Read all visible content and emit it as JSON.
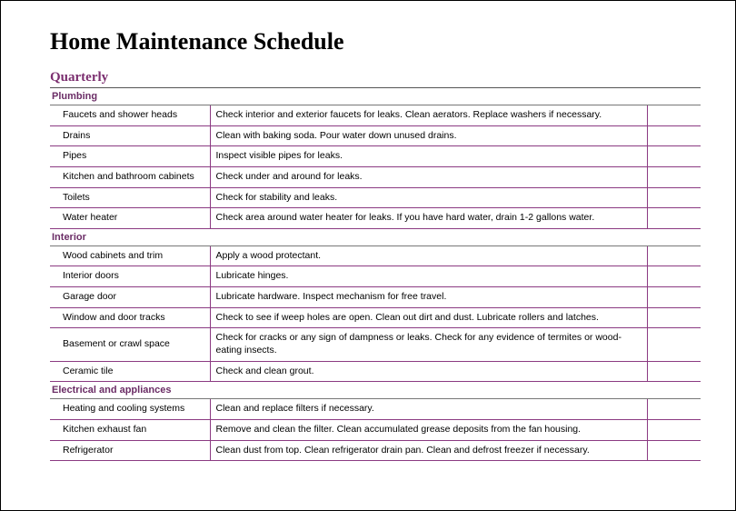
{
  "title": "Home Maintenance Schedule",
  "subtitle": "Quarterly",
  "sections": [
    {
      "name": "Plumbing",
      "rows": [
        {
          "item": "Faucets and shower heads",
          "desc": "Check interior and exterior faucets for leaks. Clean aerators. Replace washers if necessary."
        },
        {
          "item": "Drains",
          "desc": "Clean with baking soda. Pour water down unused drains."
        },
        {
          "item": "Pipes",
          "desc": "Inspect visible pipes for leaks."
        },
        {
          "item": "Kitchen and bathroom cabinets",
          "desc": "Check under and around for leaks."
        },
        {
          "item": "Toilets",
          "desc": "Check for stability and leaks."
        },
        {
          "item": "Water heater",
          "desc": "Check area around water heater for leaks. If you have hard water, drain 1-2 gallons water."
        }
      ]
    },
    {
      "name": "Interior",
      "rows": [
        {
          "item": "Wood cabinets and trim",
          "desc": "Apply a wood protectant."
        },
        {
          "item": "Interior doors",
          "desc": "Lubricate hinges."
        },
        {
          "item": "Garage door",
          "desc": "Lubricate hardware. Inspect mechanism for free travel."
        },
        {
          "item": "Window and door tracks",
          "desc": "Check to see if weep holes are open. Clean out dirt and dust. Lubricate rollers and latches."
        },
        {
          "item": "Basement or crawl space",
          "desc": "Check for cracks or any sign of dampness or leaks. Check for any evidence of termites or wood-eating insects."
        },
        {
          "item": "Ceramic tile",
          "desc": "Check and clean grout."
        }
      ]
    },
    {
      "name": "Electrical and appliances",
      "rows": [
        {
          "item": "Heating and cooling systems",
          "desc": "Clean and replace filters if necessary."
        },
        {
          "item": "Kitchen exhaust fan",
          "desc": "Remove and clean the filter. Clean accumulated grease deposits from the fan housing."
        },
        {
          "item": "Refrigerator",
          "desc": "Clean dust from top. Clean refrigerator drain pan. Clean and defrost freezer if necessary."
        }
      ]
    }
  ]
}
